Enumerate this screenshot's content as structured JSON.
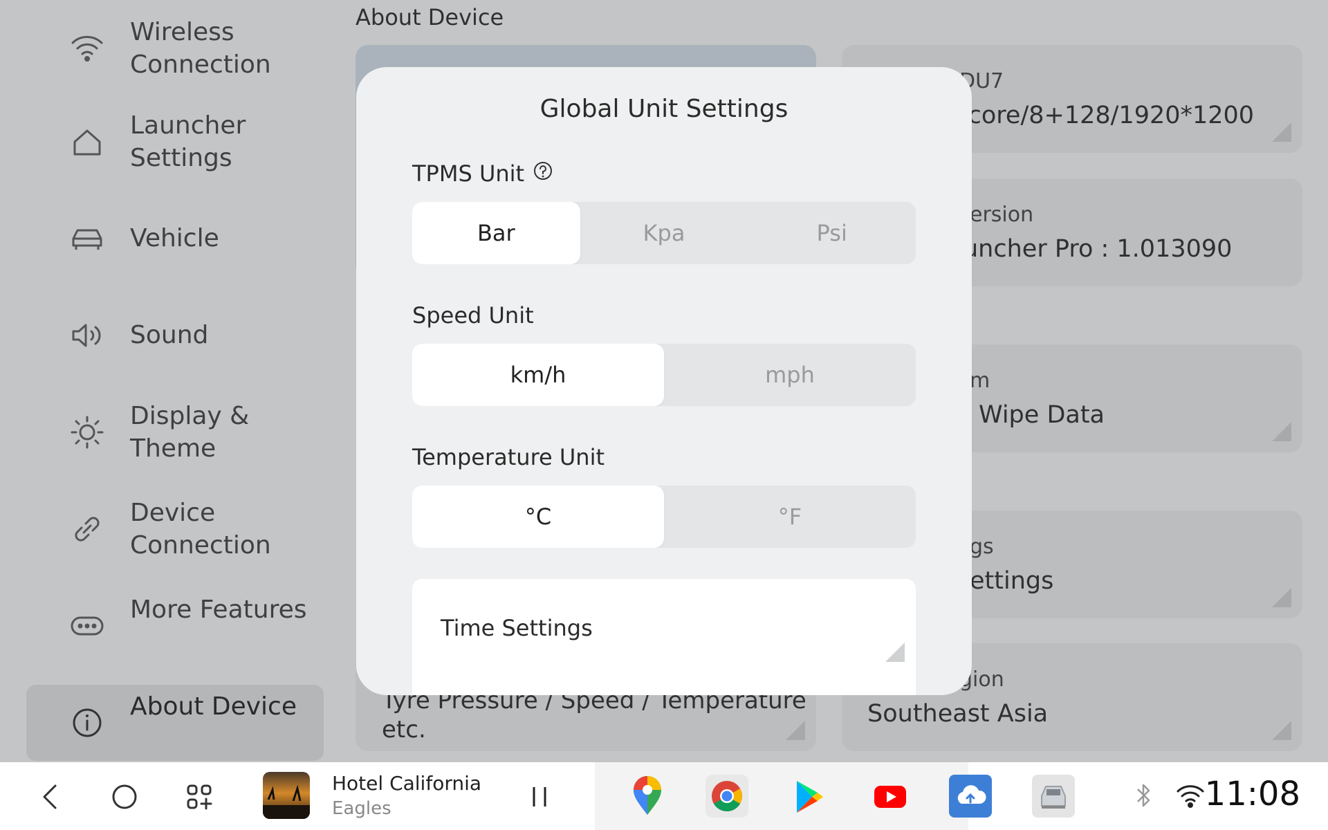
{
  "sidebar": {
    "items": [
      {
        "label": "Wireless Connection",
        "icon": "wifi-icon"
      },
      {
        "label": "Launcher Settings",
        "icon": "home-icon"
      },
      {
        "label": "Vehicle",
        "icon": "car-icon"
      },
      {
        "label": "Sound",
        "icon": "speaker-icon"
      },
      {
        "label": "Display & Theme",
        "icon": "brightness-icon"
      },
      {
        "label": "Device Connection",
        "icon": "link-icon"
      },
      {
        "label": "More Features",
        "icon": "more-icon"
      },
      {
        "label": "About Device",
        "icon": "info-icon",
        "active": true
      }
    ]
  },
  "page": {
    "title": "About Device"
  },
  "cards": {
    "model_small": "DU7",
    "model_big": "-core/8+128/1920*1200",
    "version_small": "ersion",
    "version_big": "uncher Pro : 1.013090",
    "system_small": "m",
    "system_big": "Wipe Data",
    "settings_small": "gs",
    "settings_big": "ettings",
    "region_small": "gion",
    "region_big": "Southeast Asia",
    "unit_desc_line1": "Tyre Pressure / Speed / Temperature",
    "unit_desc_line2": "etc."
  },
  "modal": {
    "title": "Global Unit Settings",
    "tpms": {
      "label": "TPMS Unit",
      "options": [
        "Bar",
        "Kpa",
        "Psi"
      ],
      "selected": "Bar"
    },
    "speed": {
      "label": "Speed Unit",
      "options": [
        "km/h",
        "mph"
      ],
      "selected": "km/h"
    },
    "temperature": {
      "label": "Temperature Unit",
      "options": [
        "°C",
        "°F"
      ],
      "selected": "°C"
    },
    "time": {
      "label": "Time Settings"
    }
  },
  "taskbar": {
    "media": {
      "title": "Hotel California",
      "artist": "Eagles"
    },
    "apps": [
      "maps-icon",
      "chrome-icon",
      "play-store-icon",
      "youtube-icon",
      "ota-icon",
      "car-app-icon"
    ],
    "clock": "11:08"
  },
  "colors": {
    "accent": "#ffffff",
    "overlay": "#c4c5c7"
  }
}
